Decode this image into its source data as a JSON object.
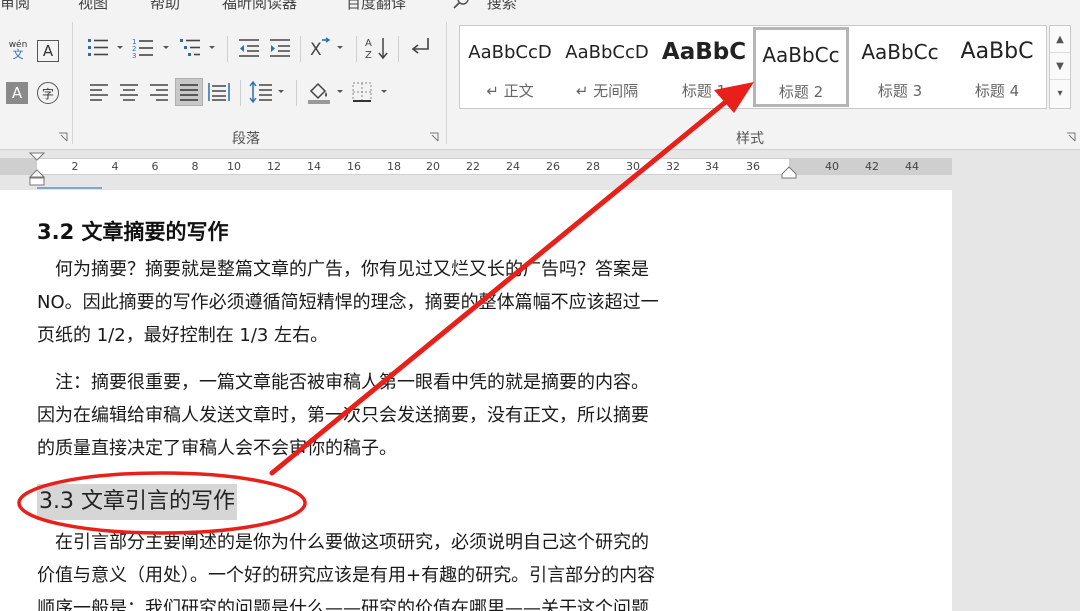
{
  "ribbon": {
    "tabs": [
      "审阅",
      "视图",
      "帮助",
      "福昕阅读器",
      "百度翻译",
      "搜索"
    ],
    "paragraph_group_label": "段落",
    "styles_group_label": "样式",
    "font_buttons": {
      "phonetic_top": "wén",
      "phonetic_bottom": "文",
      "char_border": "A",
      "char_shading": "A",
      "enclose": "字"
    }
  },
  "styles": [
    {
      "sample": "AaBbCcD",
      "name": "↵ 正文",
      "size": 18,
      "bold": false,
      "selected": false
    },
    {
      "sample": "AaBbCcD",
      "name": "↵ 无间隔",
      "size": 18,
      "bold": false,
      "selected": false
    },
    {
      "sample": "AaBbC",
      "name": "标题 1",
      "size": 24,
      "bold": true,
      "selected": false
    },
    {
      "sample": "AaBbCc",
      "name": "标题 2",
      "size": 21,
      "bold": false,
      "selected": true
    },
    {
      "sample": "AaBbCc",
      "name": "标题 3",
      "size": 21,
      "bold": false,
      "selected": false
    },
    {
      "sample": "AaBbC",
      "name": "标题 4",
      "size": 23,
      "bold": false,
      "selected": false
    }
  ],
  "ruler": {
    "ticks": [
      "2",
      "4",
      "6",
      "8",
      "10",
      "12",
      "14",
      "16",
      "18",
      "20",
      "22",
      "24",
      "26",
      "28",
      "30",
      "32",
      "34",
      "36",
      "40",
      "42",
      "44"
    ]
  },
  "document": {
    "heading_32": "3.2 文章摘要的写作",
    "para1": [
      "　何为摘要？摘要就是整篇文章的广告，你有见过又烂又长的广告吗？答案是",
      "NO。因此摘要的写作必须遵循简短精悍的理念，摘要的整体篇幅不应该超过一",
      "页纸的 1/2，最好控制在 1/3 左右。"
    ],
    "para2": [
      "　注：摘要很重要，一篇文章能否被审稿人第一眼看中凭的就是摘要的内容。",
      "因为在编辑给审稿人发送文章时，第一次只会发送摘要，没有正文，所以摘要",
      "的质量直接决定了审稿人会不会审你的稿子。"
    ],
    "heading_33": "3.3 文章引言的写作",
    "para3": [
      "　在引言部分主要阐述的是你为什么要做这项研究，必须说明自己这个研究的",
      "价值与意义（用处）。一个好的研究应该是有用+有趣的研究。引言部分的内容",
      "顺序一般是：我们研究的问题是什么——研究的价值在哪里——关于这个问题"
    ]
  },
  "annotation": {
    "color": "#e8201a"
  }
}
